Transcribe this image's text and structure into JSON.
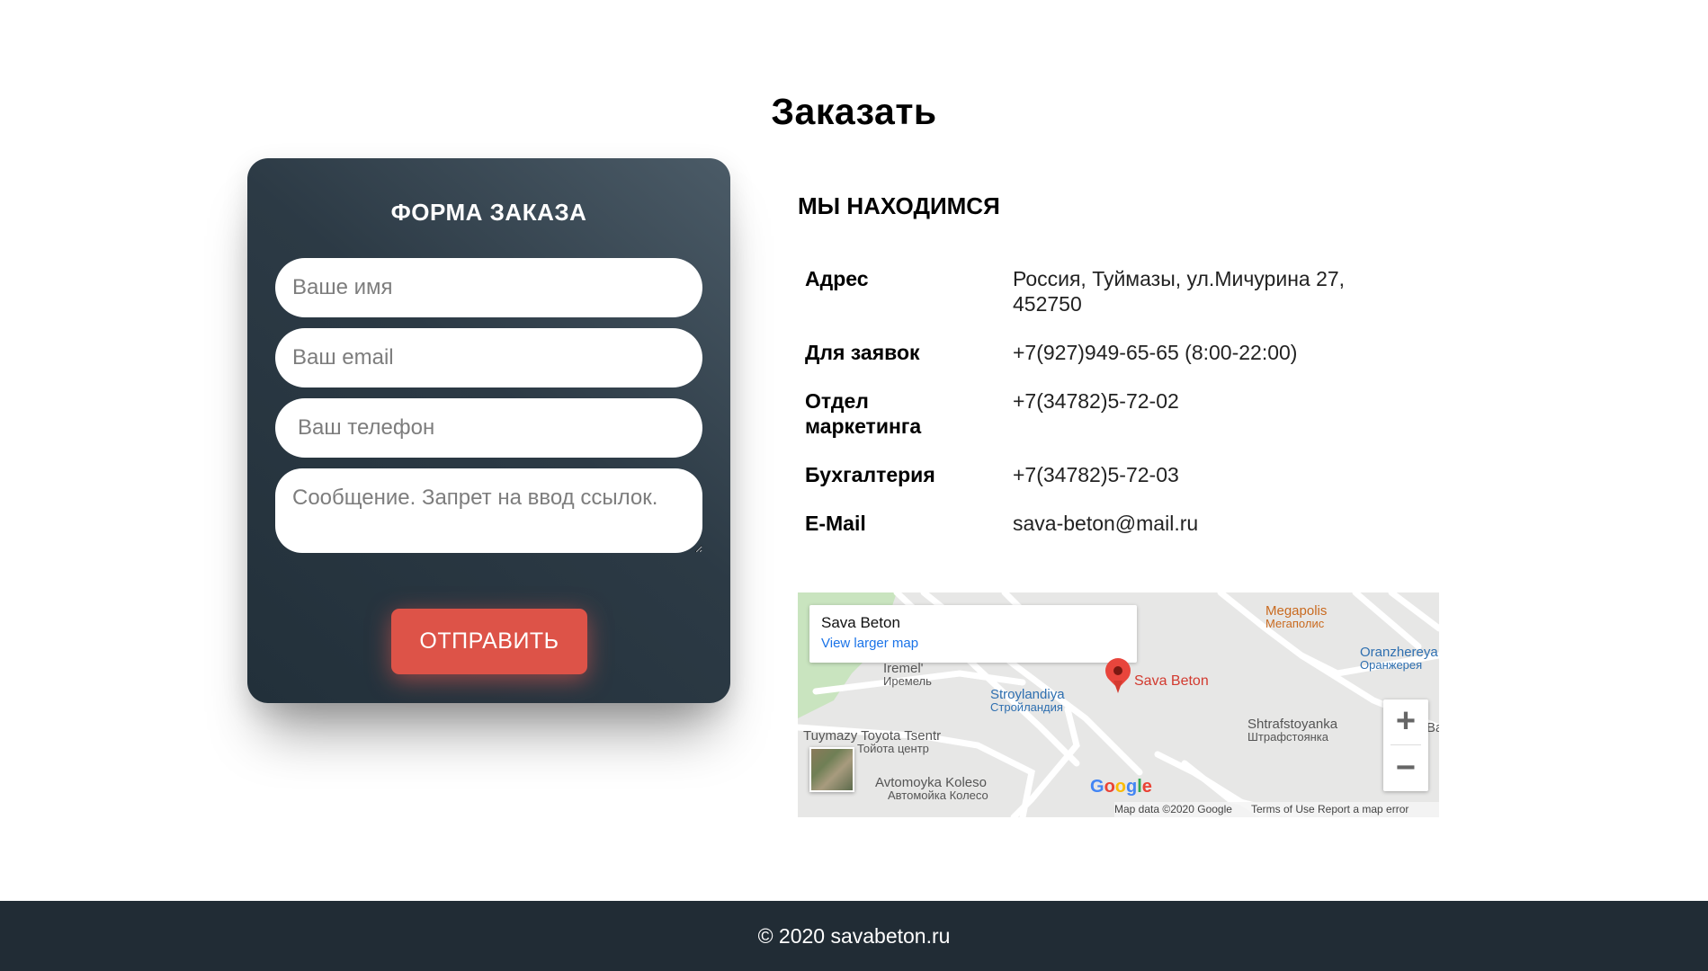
{
  "page": {
    "title": "Заказать"
  },
  "order_form": {
    "title": "ФОРМА ЗАКАЗА",
    "name_placeholder": "Ваше имя",
    "email_placeholder": "Ваш email",
    "phone_placeholder": "Ваш телефон",
    "message_placeholder": "Сообщение. Запрет на ввод ссылок.",
    "submit_label": "ОТПРАВИТЬ",
    "colors": {
      "card": "#2c3a45",
      "button": "#dd5348"
    }
  },
  "location": {
    "title": "МЫ НАХОДИМСЯ",
    "rows": [
      {
        "key": "Адрес",
        "value": "Россия, Туймазы, ул.Мичурина 27, 452750"
      },
      {
        "key": "Для заявок",
        "value": "+7(927)949-65-65 (8:00-22:00)"
      },
      {
        "key": "Отдел маркетинга",
        "value": "+7(34782)5-72-02"
      },
      {
        "key": "Бухгалтерия",
        "value": "+7(34782)5-72-03"
      },
      {
        "key": "E-Mail",
        "value": "sava-beton@mail.ru"
      }
    ]
  },
  "map": {
    "place_name": "Sava Beton",
    "larger_map_link": "View larger map",
    "marker_label": "Sava Beton",
    "pois": [
      {
        "name": "Megapolis",
        "name_ru": "Мегаполис"
      },
      {
        "name": "Oranzhereya",
        "name_ru": "Оранжерея"
      },
      {
        "name": "Iremel'",
        "name_ru": "Иремель"
      },
      {
        "name": "Stroylandiya",
        "name_ru": "Стройландия"
      },
      {
        "name": "Shtrafstoyanka",
        "name_ru": "Штрафстоянка"
      },
      {
        "name": "Tuymazy Toyota Tsentr",
        "name_ru": "Тойота центр"
      },
      {
        "name": "Avtomoyka Koleso",
        "name_ru": "Автомойка Колесо"
      }
    ],
    "edge_label": "Ba",
    "zoom_in": "+",
    "zoom_out": "−",
    "logo": "Google",
    "attribution": {
      "data": "Map data ©2020 Google",
      "terms": "Terms of Use",
      "report": "Report a map error"
    }
  },
  "footer": {
    "text": "© 2020 savabeton.ru",
    "color": "#212c35"
  }
}
